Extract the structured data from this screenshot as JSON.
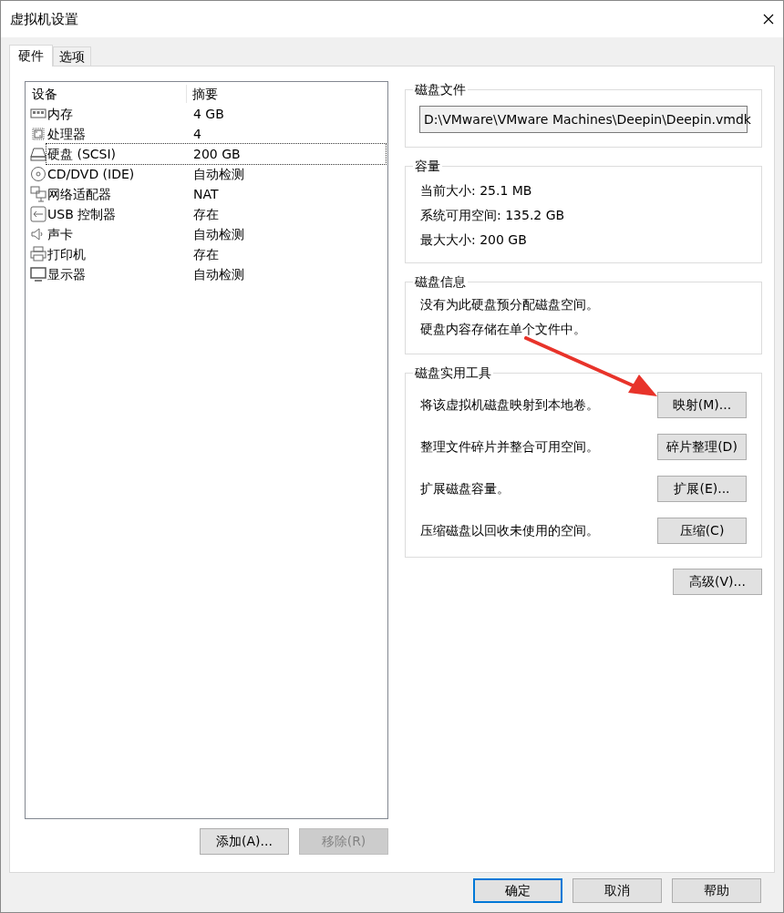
{
  "window": {
    "title": "虚拟机设置"
  },
  "tabs": [
    {
      "label": "硬件",
      "selected": true
    },
    {
      "label": "选项",
      "selected": false
    }
  ],
  "device_list": {
    "columns": [
      "设备",
      "摘要"
    ],
    "rows": [
      {
        "kind": "memory",
        "device": "内存",
        "summary": "4 GB",
        "selected": false
      },
      {
        "kind": "cpu",
        "device": "处理器",
        "summary": "4",
        "selected": false
      },
      {
        "kind": "disk",
        "device": "硬盘 (SCSI)",
        "summary": "200 GB",
        "selected": true
      },
      {
        "kind": "cd",
        "device": "CD/DVD (IDE)",
        "summary": "自动检测",
        "selected": false
      },
      {
        "kind": "network",
        "device": "网络适配器",
        "summary": "NAT",
        "selected": false
      },
      {
        "kind": "usb",
        "device": "USB 控制器",
        "summary": "存在",
        "selected": false
      },
      {
        "kind": "sound",
        "device": "声卡",
        "summary": "自动检测",
        "selected": false
      },
      {
        "kind": "printer",
        "device": "打印机",
        "summary": "存在",
        "selected": false
      },
      {
        "kind": "display",
        "device": "显示器",
        "summary": "自动检测",
        "selected": false
      }
    ],
    "buttons": [
      {
        "label": "添加(A)...",
        "disabled": false
      },
      {
        "label": "移除(R)",
        "disabled": true
      }
    ]
  },
  "disk_file": {
    "title": "磁盘文件",
    "value": "D:\\VMware\\VMware Machines\\Deepin\\Deepin.vmdk"
  },
  "capacity": {
    "title": "容量",
    "lines": [
      "当前大小: 25.1 MB",
      "系统可用空间: 135.2 GB",
      "最大大小: 200 GB"
    ]
  },
  "disk_info": {
    "title": "磁盘信息",
    "lines": [
      "没有为此硬盘预分配磁盘空间。",
      "硬盘内容存储在单个文件中。"
    ]
  },
  "disk_utilities": {
    "title": "磁盘实用工具",
    "items": [
      {
        "description": "将该虚拟机磁盘映射到本地卷。",
        "button": "映射(M)..."
      },
      {
        "description": "整理文件碎片并整合可用空间。",
        "button": "碎片整理(D)"
      },
      {
        "description": "扩展磁盘容量。",
        "button": "扩展(E)..."
      },
      {
        "description": "压缩磁盘以回收未使用的空间。",
        "button": "压缩(C)"
      }
    ]
  },
  "advanced_button": "高级(V)...",
  "dialog_buttons": [
    {
      "label": "确定",
      "default": true
    },
    {
      "label": "取消",
      "default": false
    },
    {
      "label": "帮助",
      "default": false
    }
  ]
}
